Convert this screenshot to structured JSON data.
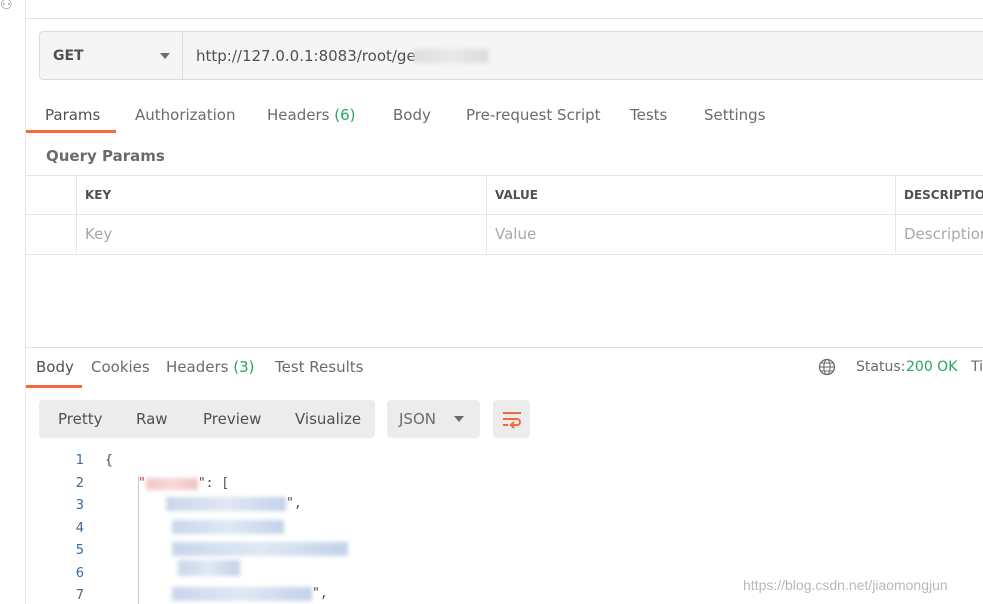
{
  "request": {
    "method": "GET",
    "url": "http://127.0.0.1:8083/root/ge"
  },
  "request_tabs": [
    {
      "label": "Params",
      "active": true
    },
    {
      "label": "Authorization"
    },
    {
      "label": "Headers",
      "count": "(6)"
    },
    {
      "label": "Body"
    },
    {
      "label": "Pre-request Script"
    },
    {
      "label": "Tests"
    },
    {
      "label": "Settings"
    }
  ],
  "query_params": {
    "title": "Query Params",
    "columns": [
      "KEY",
      "VALUE",
      "DESCRIPTION"
    ],
    "placeholders": [
      "Key",
      "Value",
      "Description"
    ]
  },
  "response_tabs": [
    {
      "label": "Body",
      "active": true
    },
    {
      "label": "Cookies"
    },
    {
      "label": "Headers",
      "count": "(3)"
    },
    {
      "label": "Test Results"
    }
  ],
  "status": {
    "label": "Status:",
    "value": "200 OK",
    "time_label": "Ti"
  },
  "view_modes": [
    "Pretty",
    "Raw",
    "Preview",
    "Visualize"
  ],
  "format": "JSON",
  "code": {
    "line_numbers": [
      "1",
      "2",
      "3",
      "4",
      "5",
      "6",
      "7"
    ],
    "open_brace": "{",
    "key_quote_open": "\"",
    "key_suffix": "\": [",
    "comma": ",",
    "quote_comma": "\","
  },
  "watermark": "https://blog.csdn.net/jiaomongjun",
  "colors": {
    "accent": "#f26b3a",
    "success": "#26a65b"
  },
  "icons": [
    "cookie-icon",
    "chevron-down-icon",
    "globe-icon",
    "wrap-lines-icon"
  ]
}
